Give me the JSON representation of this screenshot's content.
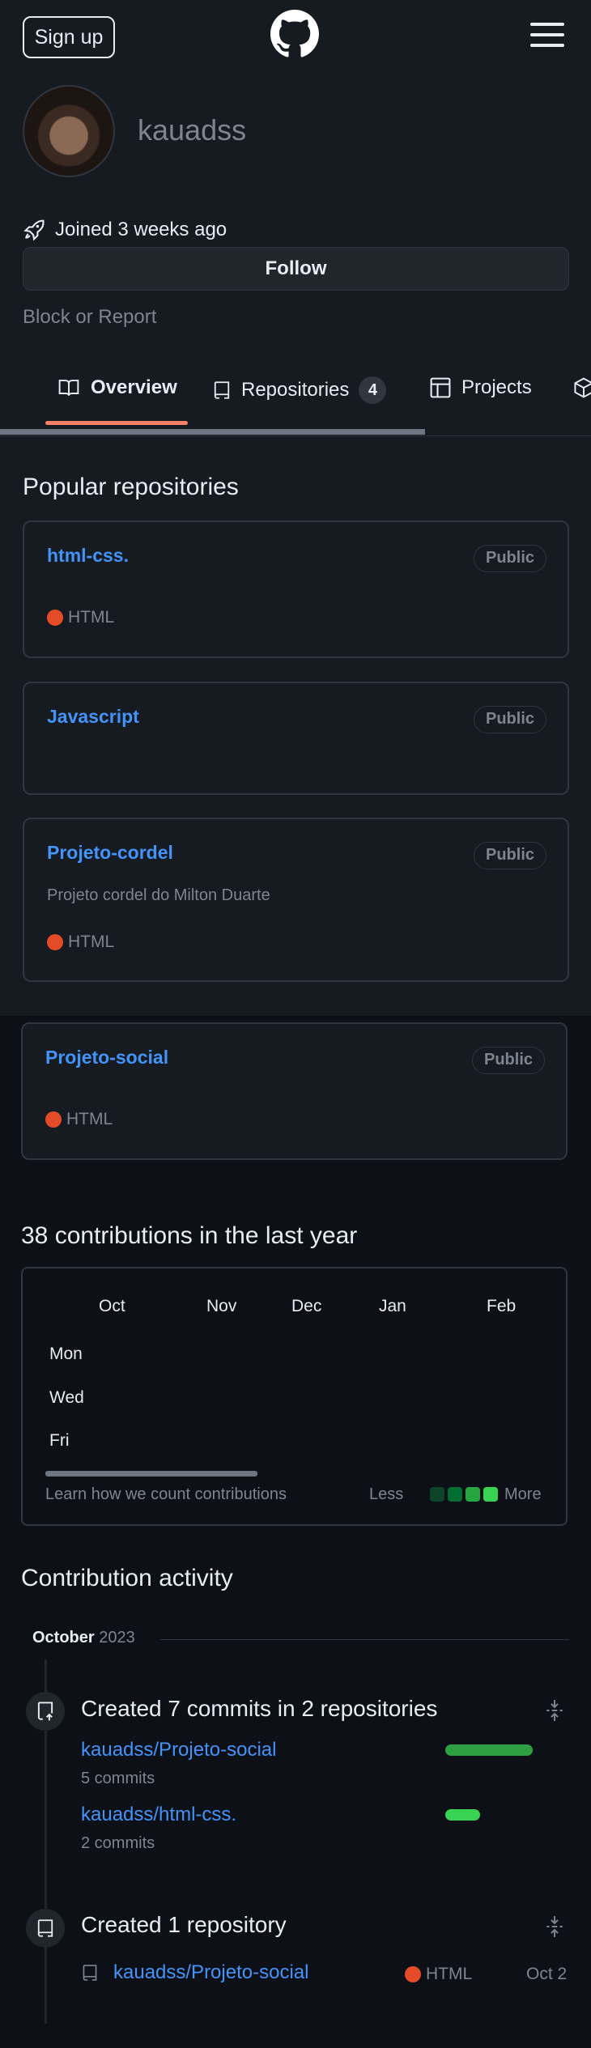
{
  "header": {
    "signup_label": "Sign up",
    "logo_icon": "github-logo-icon",
    "menu_icon": "hamburger-menu-icon"
  },
  "profile": {
    "username": "kauadss",
    "joined": "Joined 3 weeks ago",
    "follow_label": "Follow",
    "block_label": "Block or Report"
  },
  "tabs": [
    {
      "label": "Overview",
      "icon": "book-icon"
    },
    {
      "label": "Repositories",
      "icon": "repo-icon",
      "count": "4"
    },
    {
      "label": "Projects",
      "icon": "table-icon"
    }
  ],
  "popular": {
    "title": "Popular repositories",
    "repos": [
      {
        "name": "html-css.",
        "visibility": "Public",
        "language": "HTML",
        "description": ""
      },
      {
        "name": "Javascript",
        "visibility": "Public",
        "language": "",
        "description": ""
      },
      {
        "name": "Projeto-cordel",
        "visibility": "Public",
        "language": "HTML",
        "description": "Projeto cordel do Milton Duarte"
      },
      {
        "name": "Projeto-social",
        "visibility": "Public",
        "language": "HTML",
        "description": ""
      }
    ]
  },
  "contributions": {
    "title": "38 contributions in the last year",
    "months": [
      "Oct",
      "Nov",
      "Dec",
      "Jan",
      "Feb"
    ],
    "days": [
      "Mon",
      "Wed",
      "Fri"
    ],
    "learn_label": "Learn how we count contributions",
    "less_label": "Less",
    "more_label": "More",
    "legend_colors": [
      "#0e4429",
      "#006d32",
      "#26a641",
      "#39d353"
    ]
  },
  "activity": {
    "title": "Contribution activity",
    "period_month": "October",
    "period_year": "2023",
    "commits": {
      "title": "Created 7 commits in 2 repositories",
      "items": [
        {
          "repo": "kauadss/Projeto-social",
          "commits": "5 commits",
          "share": 1.0
        },
        {
          "repo": "kauadss/html-css.",
          "commits": "2 commits",
          "share": 0.4
        }
      ]
    },
    "created": {
      "title": "Created 1 repository",
      "repo": "kauadss/Projeto-social",
      "language": "HTML",
      "date": "Oct 2"
    }
  }
}
